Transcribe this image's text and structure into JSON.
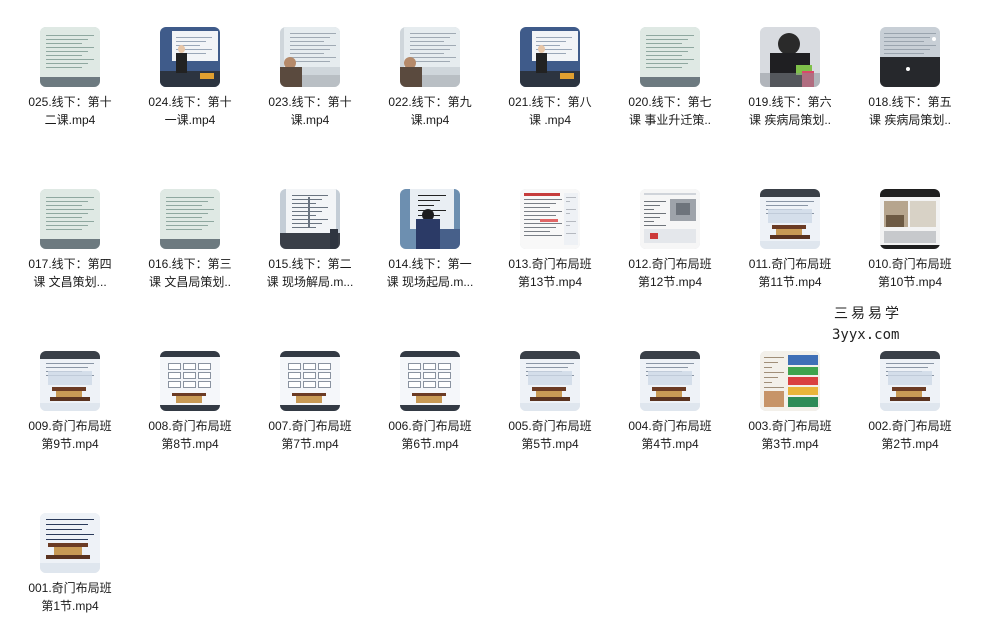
{
  "files": [
    {
      "line1": "025.线下：第十",
      "line2": "二课.mp4",
      "thumb": "classroom-screen"
    },
    {
      "line1": "024.线下：第十",
      "line2": "一课.mp4",
      "thumb": "classroom-teacher"
    },
    {
      "line1": "023.线下：第十",
      "line2": "课.mp4",
      "thumb": "classroom-screen-person"
    },
    {
      "line1": "022.线下：第九",
      "line2": "课.mp4",
      "thumb": "classroom-screen-person"
    },
    {
      "line1": "021.线下：第八",
      "line2": "课 .mp4",
      "thumb": "classroom-teacher"
    },
    {
      "line1": "020.线下：第七",
      "line2": "课 事业升迁策..",
      "thumb": "classroom-screen"
    },
    {
      "line1": "019.线下：第六",
      "line2": "课 疾病局策划..",
      "thumb": "person-closeup"
    },
    {
      "line1": "018.线下：第五",
      "line2": "课 疾病局策划..",
      "thumb": "dark-screen"
    },
    {
      "line1": "017.线下：第四",
      "line2": "课 文昌策划...",
      "thumb": "classroom-screen"
    },
    {
      "line1": "016.线下：第三",
      "line2": "课 文昌局策划..",
      "thumb": "classroom-screen"
    },
    {
      "line1": "015.线下：第二",
      "line2": "课 现场解局.m...",
      "thumb": "whiteboard-person"
    },
    {
      "line1": "014.线下：第一",
      "line2": "课 现场起局.m...",
      "thumb": "whiteboard-writing"
    },
    {
      "line1": "013.奇门布局班",
      "line2": "第13节.mp4",
      "thumb": "document"
    },
    {
      "line1": "012.奇门布局班",
      "line2": "第12节.mp4",
      "thumb": "document-photo"
    },
    {
      "line1": "011.奇门布局班",
      "line2": "第11节.mp4",
      "thumb": "palace-slide"
    },
    {
      "line1": "010.奇门布局班",
      "line2": "第10节.mp4",
      "thumb": "room-photo"
    },
    {
      "line1": "009.奇门布局班",
      "line2": "第9节.mp4",
      "thumb": "palace-slide"
    },
    {
      "line1": "008.奇门布局班",
      "line2": "第8节.mp4",
      "thumb": "spreadsheet-slide"
    },
    {
      "line1": "007.奇门布局班",
      "line2": "第7节.mp4",
      "thumb": "spreadsheet-slide"
    },
    {
      "line1": "006.奇门布局班",
      "line2": "第6节.mp4",
      "thumb": "spreadsheet-slide"
    },
    {
      "line1": "005.奇门布局班",
      "line2": "第5节.mp4",
      "thumb": "palace-slide"
    },
    {
      "line1": "004.奇门布局班",
      "line2": "第4节.mp4",
      "thumb": "palace-slide"
    },
    {
      "line1": "003.奇门布局班",
      "line2": "第3节.mp4",
      "thumb": "colorful-slide"
    },
    {
      "line1": "002.奇门布局班",
      "line2": "第2节.mp4",
      "thumb": "palace-slide"
    },
    {
      "line1": "001.奇门布局班",
      "line2": "第1节.mp4",
      "thumb": "palace-title-slide"
    }
  ],
  "watermark": {
    "chinese": "三易易学",
    "domain": "3yyx.com"
  }
}
